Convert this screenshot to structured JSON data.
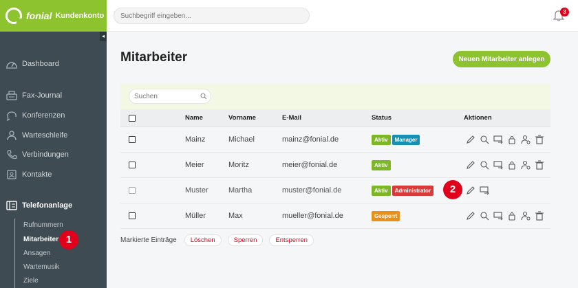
{
  "brand": {
    "name": "fonial",
    "subtitle": "Kundenkonto"
  },
  "sidebar": {
    "collapse_glyph": "◂",
    "items": [
      {
        "label": "Dashboard",
        "icon": "gauge-icon"
      },
      {
        "label": "Fax-Journal",
        "icon": "fax-icon"
      },
      {
        "label": "Konferenzen",
        "icon": "conference-icon"
      },
      {
        "label": "Warteschleife",
        "icon": "queue-icon"
      },
      {
        "label": "Verbindungen",
        "icon": "phone-icon"
      },
      {
        "label": "Kontakte",
        "icon": "contacts-icon"
      },
      {
        "label": "Telefonanlage",
        "icon": "pbx-icon"
      }
    ],
    "sub_items": [
      "Rufnummern",
      "Mitarbeiter",
      "Ansagen",
      "Wartemusik",
      "Ziele"
    ]
  },
  "annotations": {
    "one": "1",
    "two": "2"
  },
  "topbar": {
    "search_placeholder": "Suchbegriff eingeben...",
    "notification_count": "3"
  },
  "page": {
    "title": "Mitarbeiter",
    "add_button": "Neuen Mitarbeiter anlegen"
  },
  "filter": {
    "placeholder": "Suchen"
  },
  "table": {
    "headers": {
      "name": "Name",
      "vorname": "Vorname",
      "email": "E-Mail",
      "status": "Status",
      "aktionen": "Aktionen"
    },
    "rows": [
      {
        "name": "Mainz",
        "vorname": "Michael",
        "email": "mainz@fonial.de",
        "tags": [
          "Aktiv",
          "Manager"
        ]
      },
      {
        "name": "Meier",
        "vorname": "Moritz",
        "email": "meier@fonial.de",
        "tags": [
          "Aktiv"
        ]
      },
      {
        "name": "Muster",
        "vorname": "Martha",
        "email": "muster@fonial.de",
        "tags": [
          "Aktiv",
          "Administrator"
        ]
      },
      {
        "name": "Müller",
        "vorname": "Max",
        "email": "mueller@fonial.de",
        "tags": [
          "Gesperrt"
        ]
      }
    ]
  },
  "bulk": {
    "label": "Markierte Einträge",
    "delete": "Löschen",
    "lock": "Sperren",
    "unlock": "Entsperren"
  },
  "colors": {
    "brand_green": "#8cc32e",
    "sidebar_bg": "#3e4b52",
    "danger_red": "#e0001b",
    "manager_blue": "#168fb4",
    "admin_red": "#d83a3a",
    "gesperrt_orange": "#e8911a"
  }
}
